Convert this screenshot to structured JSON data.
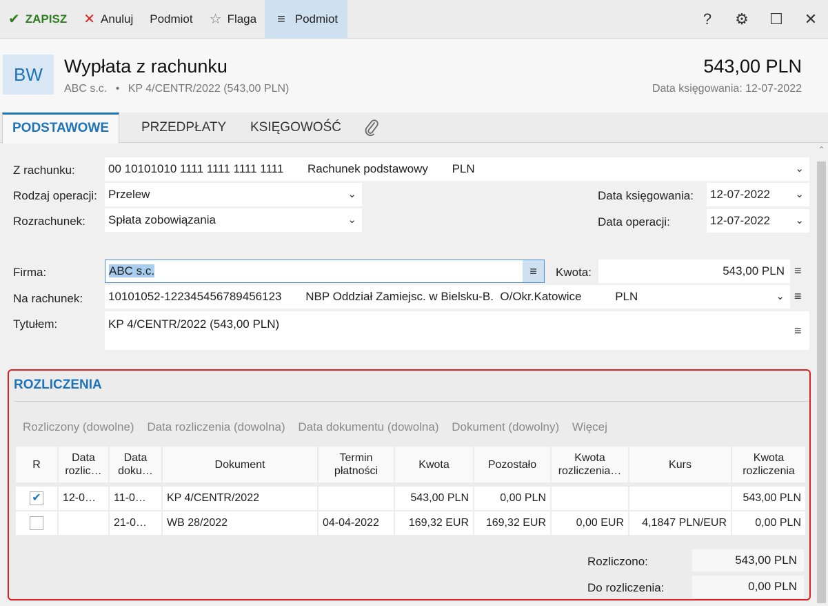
{
  "toolbar": {
    "save": "ZAPISZ",
    "cancel": "Anuluj",
    "subject": "Podmiot",
    "flag": "Flaga",
    "menu_subject": "Podmiot"
  },
  "header": {
    "badge": "BW",
    "title": "Wypłata z rachunku",
    "subtitle_company": "ABC s.c.",
    "subtitle_sep": "•",
    "subtitle_doc": "KP 4/CENTR/2022 (543,00 PLN)",
    "amount": "543,00 PLN",
    "date_line": "Data księgowania: 12-07-2022"
  },
  "tabs": [
    "PODSTAWOWE",
    "PRZEDPŁATY",
    "KSIĘGOWOŚĆ"
  ],
  "form": {
    "z_rachunku_label": "Z rachunku:",
    "z_rachunku_number": "00 10101010 1111 1111 1111 1111",
    "z_rachunku_name": "Rachunek podstawowy",
    "z_rachunku_currency": "PLN",
    "rodzaj_label": "Rodzaj operacji:",
    "rodzaj_value": "Przelew",
    "rozrachunek_label": "Rozrachunek:",
    "rozrachunek_value": "Spłata zobowiązania",
    "data_ksieg_label": "Data księgowania:",
    "data_ksieg_value": "12-07-2022",
    "data_oper_label": "Data operacji:",
    "data_oper_value": "12-07-2022",
    "firma_label": "Firma:",
    "firma_value": "ABC s.c.",
    "kwota_label": "Kwota:",
    "kwota_value": "543,00 PLN",
    "na_rachunek_label": "Na rachunek:",
    "na_rachunek_number": "10101052-122345456789456123",
    "na_rachunek_bank": "NBP Oddział Zamiejsc. w Bielsku-B.  O/Okr.Katowice",
    "na_rachunek_currency": "PLN",
    "tytulem_label": "Tytułem:",
    "tytulem_value": "KP 4/CENTR/2022 (543,00 PLN)"
  },
  "rozliczenia": {
    "title": "ROZLICZENIA",
    "filters": [
      "Rozliczony (dowolne)",
      "Data rozliczenia (dowolna)",
      "Data dokumentu (dowolna)",
      "Dokument (dowolny)",
      "Więcej"
    ],
    "columns": [
      "R",
      "Data rozlic…",
      "Data doku…",
      "Dokument",
      "Termin płatności",
      "Kwota",
      "Pozostało",
      "Kwota rozliczenia…",
      "Kurs",
      "Kwota rozliczenia"
    ],
    "rows": [
      {
        "checked": true,
        "data_rozl": "12-0…",
        "data_dok": "11-0…",
        "dokument": "KP 4/CENTR/2022",
        "termin": "",
        "kwota": "543,00 PLN",
        "pozostalo": "0,00 PLN",
        "kwota_rozl_wal": "",
        "kurs": "",
        "kwota_rozl": "543,00 PLN"
      },
      {
        "checked": false,
        "data_rozl": "",
        "data_dok": "21-0…",
        "dokument": "WB 28/2022",
        "termin": "04-04-2022",
        "kwota": "169,32 EUR",
        "pozostalo": "169,32 EUR",
        "kwota_rozl_wal": "0,00 EUR",
        "kurs": "4,1847 PLN/EUR",
        "kwota_rozl": "0,00 PLN"
      }
    ],
    "rozliczono_label": "Rozliczono:",
    "rozliczono_value": "543,00 PLN",
    "do_rozliczenia_label": "Do rozliczenia:",
    "do_rozliczenia_value": "0,00 PLN"
  }
}
